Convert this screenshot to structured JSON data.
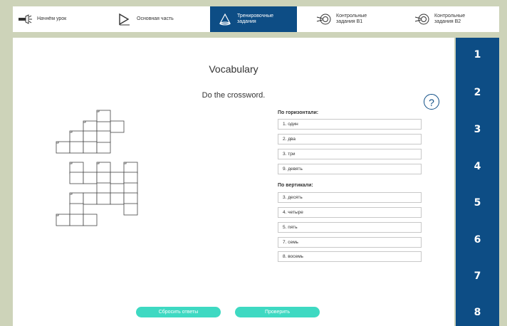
{
  "nav": {
    "tabs": [
      {
        "label": "Начнём урок",
        "icon": "flashlight-icon"
      },
      {
        "label": "Основная часть",
        "icon": "play-icon"
      },
      {
        "label": "Тренировочные\nзадания",
        "icon": "cone-icon",
        "active": true
      },
      {
        "label": "Контрольные\nзадания В1",
        "icon": "target-icon"
      },
      {
        "label": "Контрольные\nзадания В2",
        "icon": "target-icon"
      }
    ]
  },
  "main": {
    "title": "Vocabulary",
    "instruction": "Do the crossword.",
    "help_symbol": "?"
  },
  "clues": {
    "across_heading": "По горизонтали:",
    "across": [
      "1.  один",
      "2.  два",
      "3.  три",
      "9.  девять"
    ],
    "down_heading": "По вертикали:",
    "down": [
      "3.  десять",
      "4.  четыре",
      "5.  пять",
      "7.  семь",
      "8.  восемь"
    ]
  },
  "buttons": {
    "reset": "Сбросить ответы",
    "check": "Проверить"
  },
  "sidebar": {
    "numbers": [
      "1",
      "2",
      "3",
      "4",
      "5",
      "6",
      "7",
      "8"
    ]
  },
  "colors": {
    "primary": "#0d4d85",
    "accent": "#3ed9c2",
    "background": "#cdd3b9"
  }
}
